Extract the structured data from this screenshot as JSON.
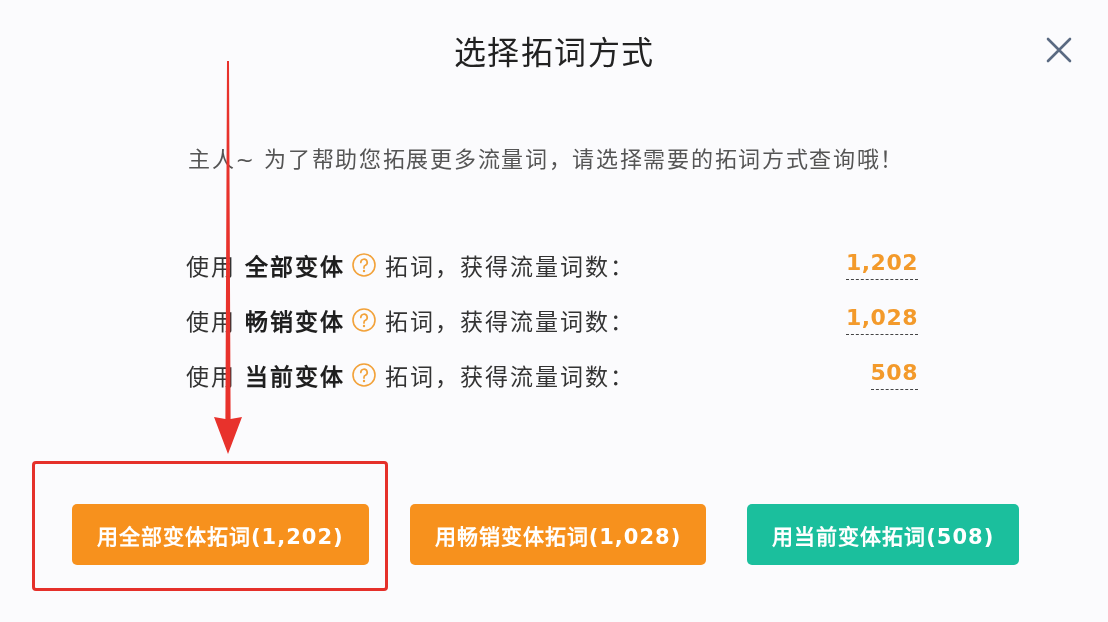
{
  "dialog": {
    "title": "选择拓词方式",
    "intro": "主人~ 为了帮助您拓展更多流量词，请选择需要的拓词方式查询哦！"
  },
  "options": [
    {
      "lead": "使用 **全部变体**",
      "suffix": "拓词，获得流量词数：",
      "count": "1,202"
    },
    {
      "lead": "使用 **畅销变体**",
      "suffix": "拓词，获得流量词数：",
      "count": "1,028"
    },
    {
      "lead": "使用 **当前变体**",
      "suffix": "拓词，获得流量词数：",
      "count": "508"
    }
  ],
  "buttons": [
    {
      "label": "用全部变体拓词(1,202)",
      "color": "#f7911d",
      "highlighted": true
    },
    {
      "label": "用畅销变体拓词(1,028)",
      "color": "#f7911d",
      "highlighted": false
    },
    {
      "label": "用当前变体拓词(508)",
      "color": "#1bbf9d",
      "highlighted": false
    }
  ]
}
